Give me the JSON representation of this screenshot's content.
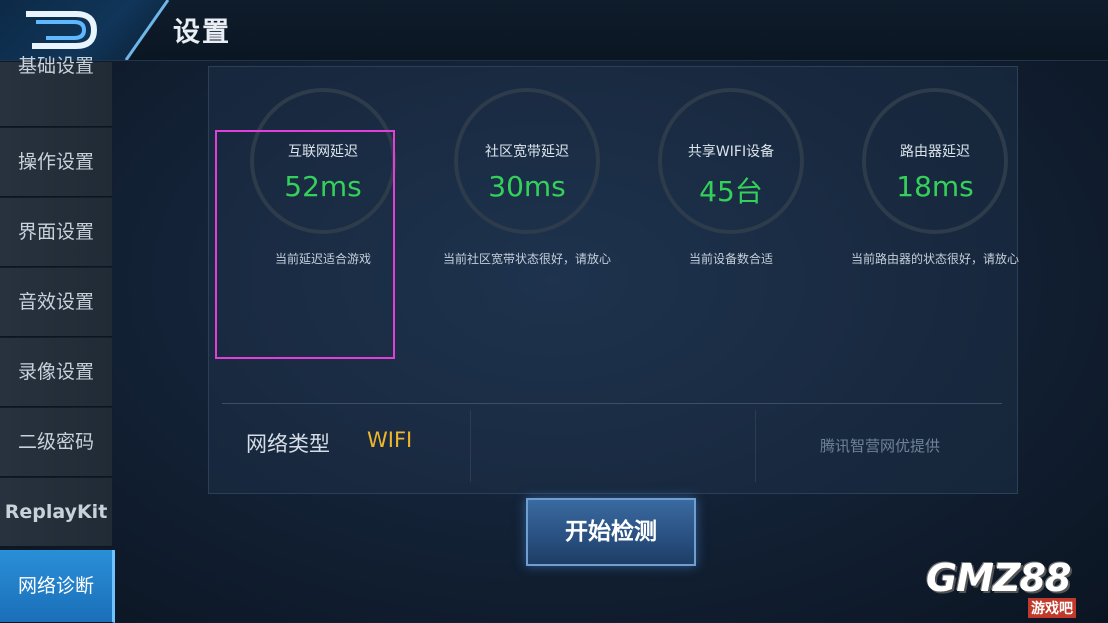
{
  "header": {
    "title": "设置"
  },
  "sidebar": {
    "items": [
      {
        "label": "基础设置"
      },
      {
        "label": "操作设置"
      },
      {
        "label": "界面设置"
      },
      {
        "label": "音效设置"
      },
      {
        "label": "录像设置"
      },
      {
        "label": "二级密码"
      },
      {
        "label": "ReplayKit"
      },
      {
        "label": "网络诊断",
        "active": true
      }
    ]
  },
  "metrics": [
    {
      "label": "互联网延迟",
      "value": "52ms",
      "desc": "当前延迟适合游戏"
    },
    {
      "label": "社区宽带延迟",
      "value": "30ms",
      "desc": "当前社区宽带状态很好，请放心"
    },
    {
      "label": "共享WIFI设备",
      "value": "45台",
      "desc": "当前设备数合适"
    },
    {
      "label": "路由器延迟",
      "value": "18ms",
      "desc": "当前路由器的状态很好，请放心"
    }
  ],
  "network": {
    "type_label": "网络类型",
    "type_value": "WIFI",
    "provider": "腾讯智营网优提供"
  },
  "actions": {
    "start_label": "开始检测"
  },
  "watermark": {
    "text": "GMZ88",
    "sub": "游戏吧"
  },
  "colors": {
    "value_green": "#34d15a",
    "wifi_gold": "#f0b52a",
    "highlight": "#e040d8",
    "active_tab": "#2a8fd8"
  }
}
